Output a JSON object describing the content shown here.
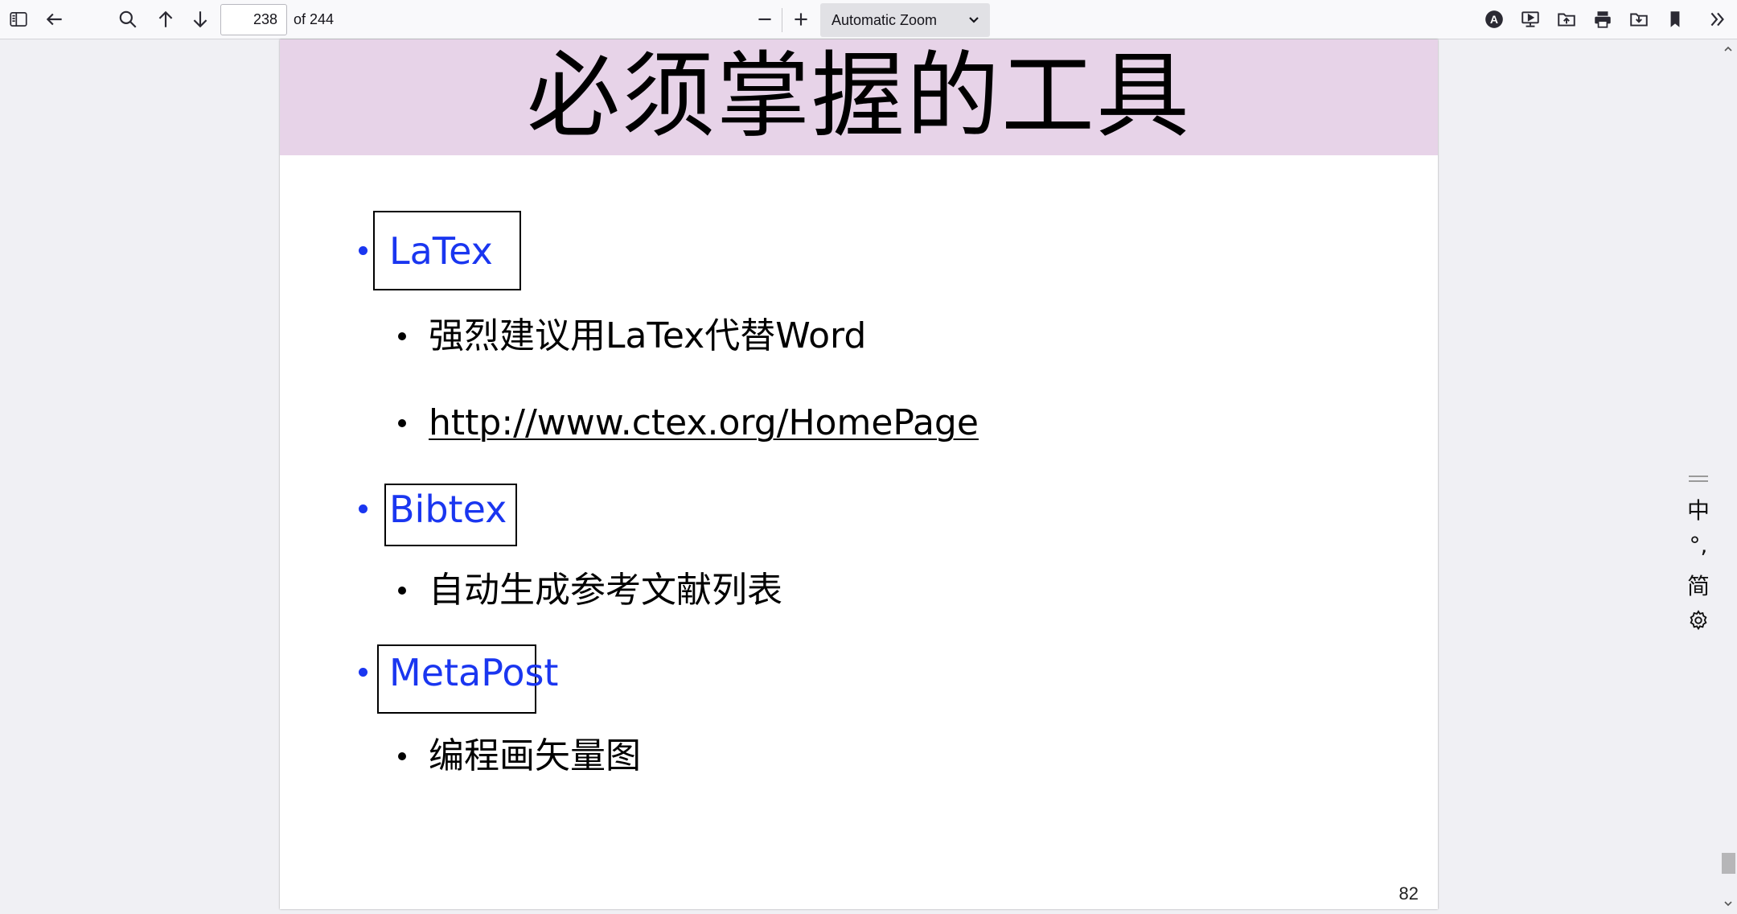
{
  "toolbar": {
    "page_number": "238",
    "page_count_text": "of 244",
    "zoom_label": "Automatic Zoom",
    "icons": [
      "sidebar-toggle-icon",
      "back-icon",
      "search-icon",
      "previous-page-icon",
      "next-page-icon",
      "zoom-out-icon",
      "zoom-in-icon",
      "accessibility-icon",
      "presentation-icon",
      "open-file-icon",
      "print-icon",
      "save-icon",
      "bookmark-icon",
      "tools-menu-icon"
    ]
  },
  "slide": {
    "title": "必须掌握的工具",
    "items": [
      {
        "label": "LaTex",
        "subitems": [
          "强烈建议用LaTex代替Word",
          "http://www.ctex.org/HomePage"
        ]
      },
      {
        "label": "Bibtex",
        "subitems": [
          "自动生成参考文献列表"
        ]
      },
      {
        "label": "MetaPost",
        "subitems": [
          "编程画矢量图"
        ]
      }
    ],
    "page_number": "82"
  },
  "ime": {
    "mode": "中",
    "punct": "°,",
    "script": "简"
  },
  "colors": {
    "title_band": "#e7d3e8",
    "level1_text": "#1a36f0",
    "toolbar_bg": "#f9f9fb",
    "viewer_bg": "#f0f0f4"
  }
}
